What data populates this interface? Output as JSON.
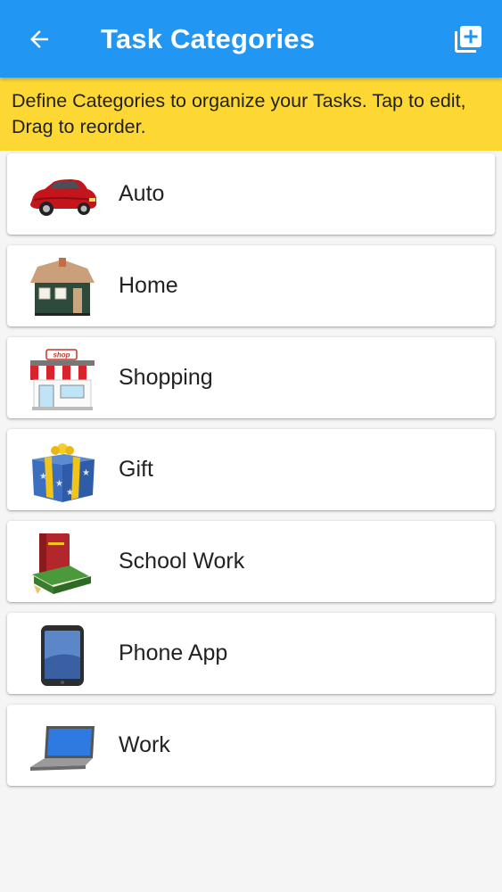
{
  "appbar": {
    "title": "Task Categories",
    "back_icon": "arrow-back-icon",
    "add_icon": "library-add-icon",
    "background": "#2196f3"
  },
  "banner": {
    "text": "Define Categories to organize your Tasks. Tap to edit, Drag to reorder.",
    "background": "#fdd835"
  },
  "categories": [
    {
      "label": "Auto",
      "icon": "car-icon"
    },
    {
      "label": "Home",
      "icon": "house-icon"
    },
    {
      "label": "Shopping",
      "icon": "shop-icon",
      "icon_text": "shop"
    },
    {
      "label": "Gift",
      "icon": "gift-icon"
    },
    {
      "label": "School Work",
      "icon": "books-icon"
    },
    {
      "label": "Phone App",
      "icon": "smartphone-icon"
    },
    {
      "label": "Work",
      "icon": "laptop-icon"
    }
  ]
}
